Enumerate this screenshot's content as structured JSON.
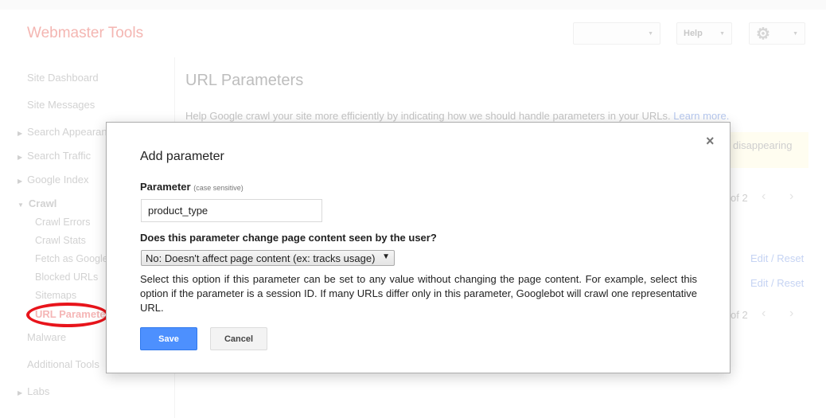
{
  "header": {
    "logo": "Webmaster Tools",
    "site_select": "",
    "help": "Help",
    "settings_icon": "gear-icon"
  },
  "sidebar": {
    "items": [
      {
        "label": "Site Dashboard"
      },
      {
        "label": "Site Messages"
      },
      {
        "label": "Search Appearance"
      },
      {
        "label": "Search Traffic"
      },
      {
        "label": "Google Index"
      },
      {
        "label": "Crawl"
      },
      {
        "label": "Crawl Errors"
      },
      {
        "label": "Crawl Stats"
      },
      {
        "label": "Fetch as Google"
      },
      {
        "label": "Blocked URLs"
      },
      {
        "label": "Sitemaps"
      },
      {
        "label": "URL Parameters"
      },
      {
        "label": "Malware"
      },
      {
        "label": "Additional Tools"
      },
      {
        "label": "Labs"
      }
    ]
  },
  "main": {
    "title": "URL Parameters",
    "help_text": "Help Google crawl your site more efficiently by indicating how we should handle parameters in your URLs.",
    "learn_more": "Learn more.",
    "notice": "disappearing",
    "pager_top": "of 2",
    "pager_bottom": "of 2",
    "edit": "Edit",
    "sep": "/",
    "reset": "Reset"
  },
  "modal": {
    "title": "Add parameter",
    "close": "×",
    "param_label": "Parameter",
    "param_hint": "(case sensitive)",
    "param_value": "product_type",
    "question": "Does this parameter change page content seen by the user?",
    "select_value": "No: Doesn't affect page content (ex: tracks usage)",
    "description": "Select this option if this parameter can be set to any value without changing the page content. For example, select this option if the parameter is a session ID. If many URLs differ only in this parameter, Googlebot will crawl one representative URL.",
    "save": "Save",
    "cancel": "Cancel"
  },
  "colors": {
    "save": "#4d90fe",
    "highlight": "#e8141b"
  }
}
